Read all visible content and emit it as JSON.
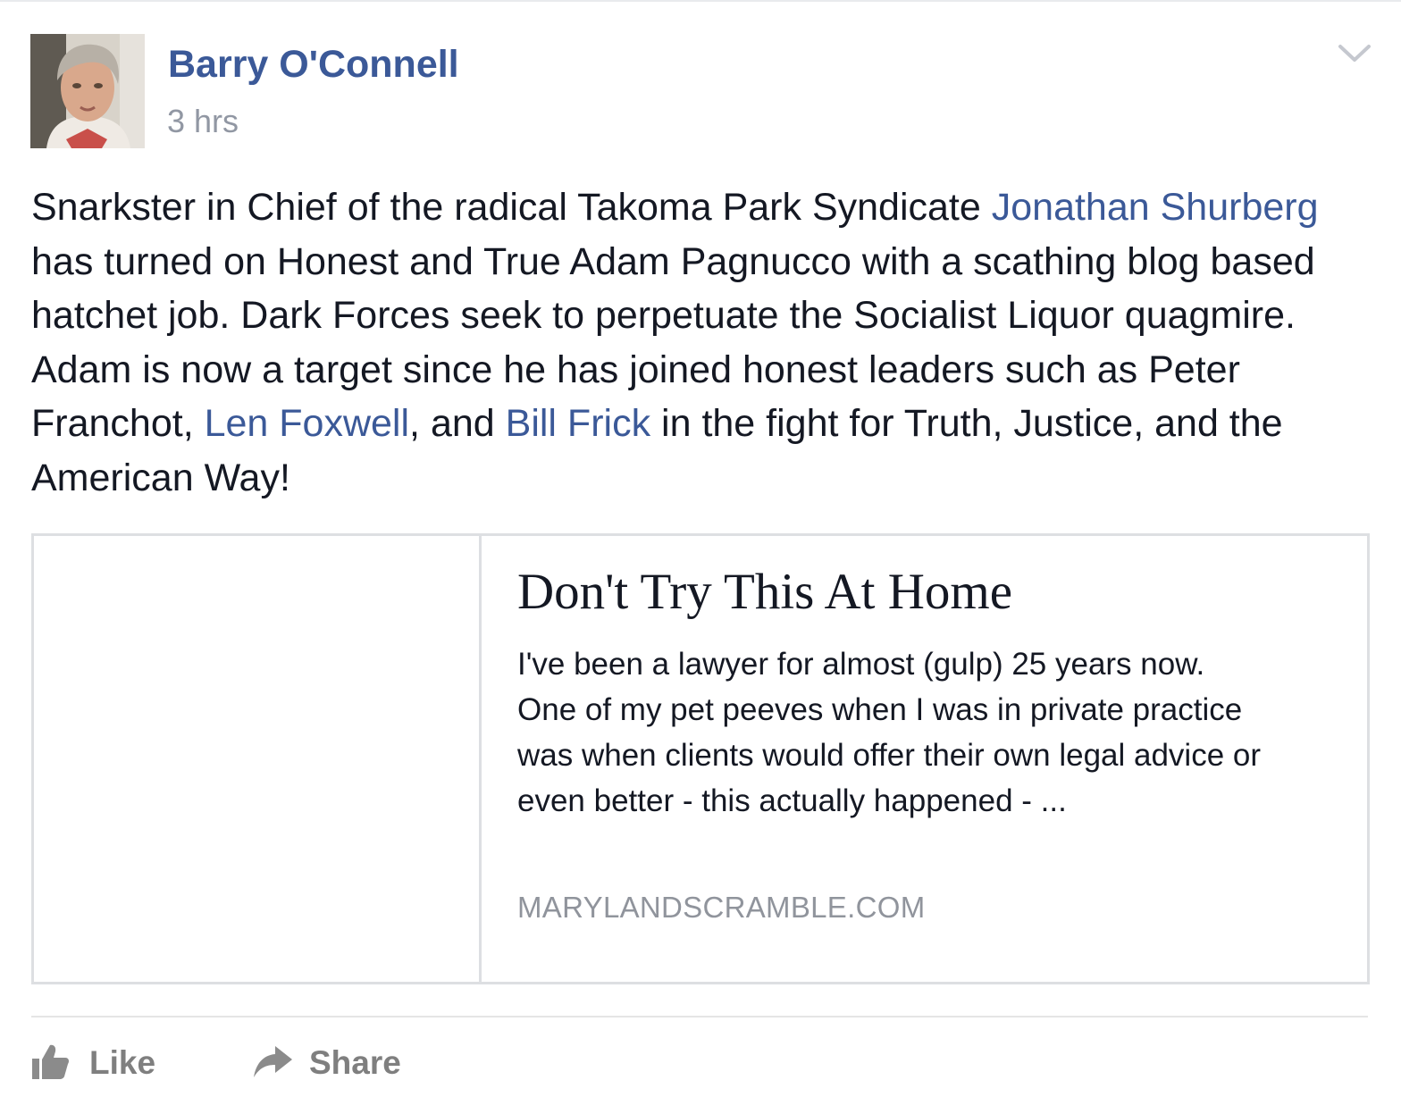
{
  "post": {
    "author": "Barry O'Connell",
    "timestamp": "3 hrs",
    "menu_icon": "chevron-down-icon",
    "text_lines": [
      [
        {
          "text": "Snarkster in Chief of the radical Takoma Park Syndicate ",
          "link": false
        },
        {
          "text": "Jonathan Shurberg",
          "link": true
        }
      ],
      [
        {
          "text": "has turned on Honest and True Adam Pagnucco with a scathing blog based",
          "link": false
        }
      ],
      [
        {
          "text": "hatchet job. Dark Forces seek to perpetuate the Socialist Liquor quagmire.",
          "link": false
        }
      ],
      [
        {
          "text": "Adam is now a target since he has joined honest leaders such as Peter",
          "link": false
        }
      ],
      [
        {
          "text": "Franchot, ",
          "link": false
        },
        {
          "text": "Len Foxwell",
          "link": true
        },
        {
          "text": ", and ",
          "link": false
        },
        {
          "text": "Bill Frick",
          "link": true
        },
        {
          "text": " in the fight for Truth, Justice, and the",
          "link": false
        }
      ],
      [
        {
          "text": "American Way!",
          "link": false
        }
      ]
    ]
  },
  "link_preview": {
    "title": "Don't Try This At Home",
    "description_lines": [
      "I've been a lawyer for almost (gulp) 25 years now.",
      "One of my pet peeves when I was in private practice",
      "was when clients would offer their own legal advice or",
      "even better - this actually happened - ..."
    ],
    "domain": "MARYLANDSCRAMBLE.COM"
  },
  "actions": {
    "like_label": "Like",
    "share_label": "Share",
    "like_icon": "thumbs-up-icon",
    "share_icon": "share-arrow-icon"
  },
  "colors": {
    "link_blue": "#3b5998",
    "text": "#141823",
    "meta_gray": "#9197a3",
    "action_gray": "#7f7f7f"
  }
}
